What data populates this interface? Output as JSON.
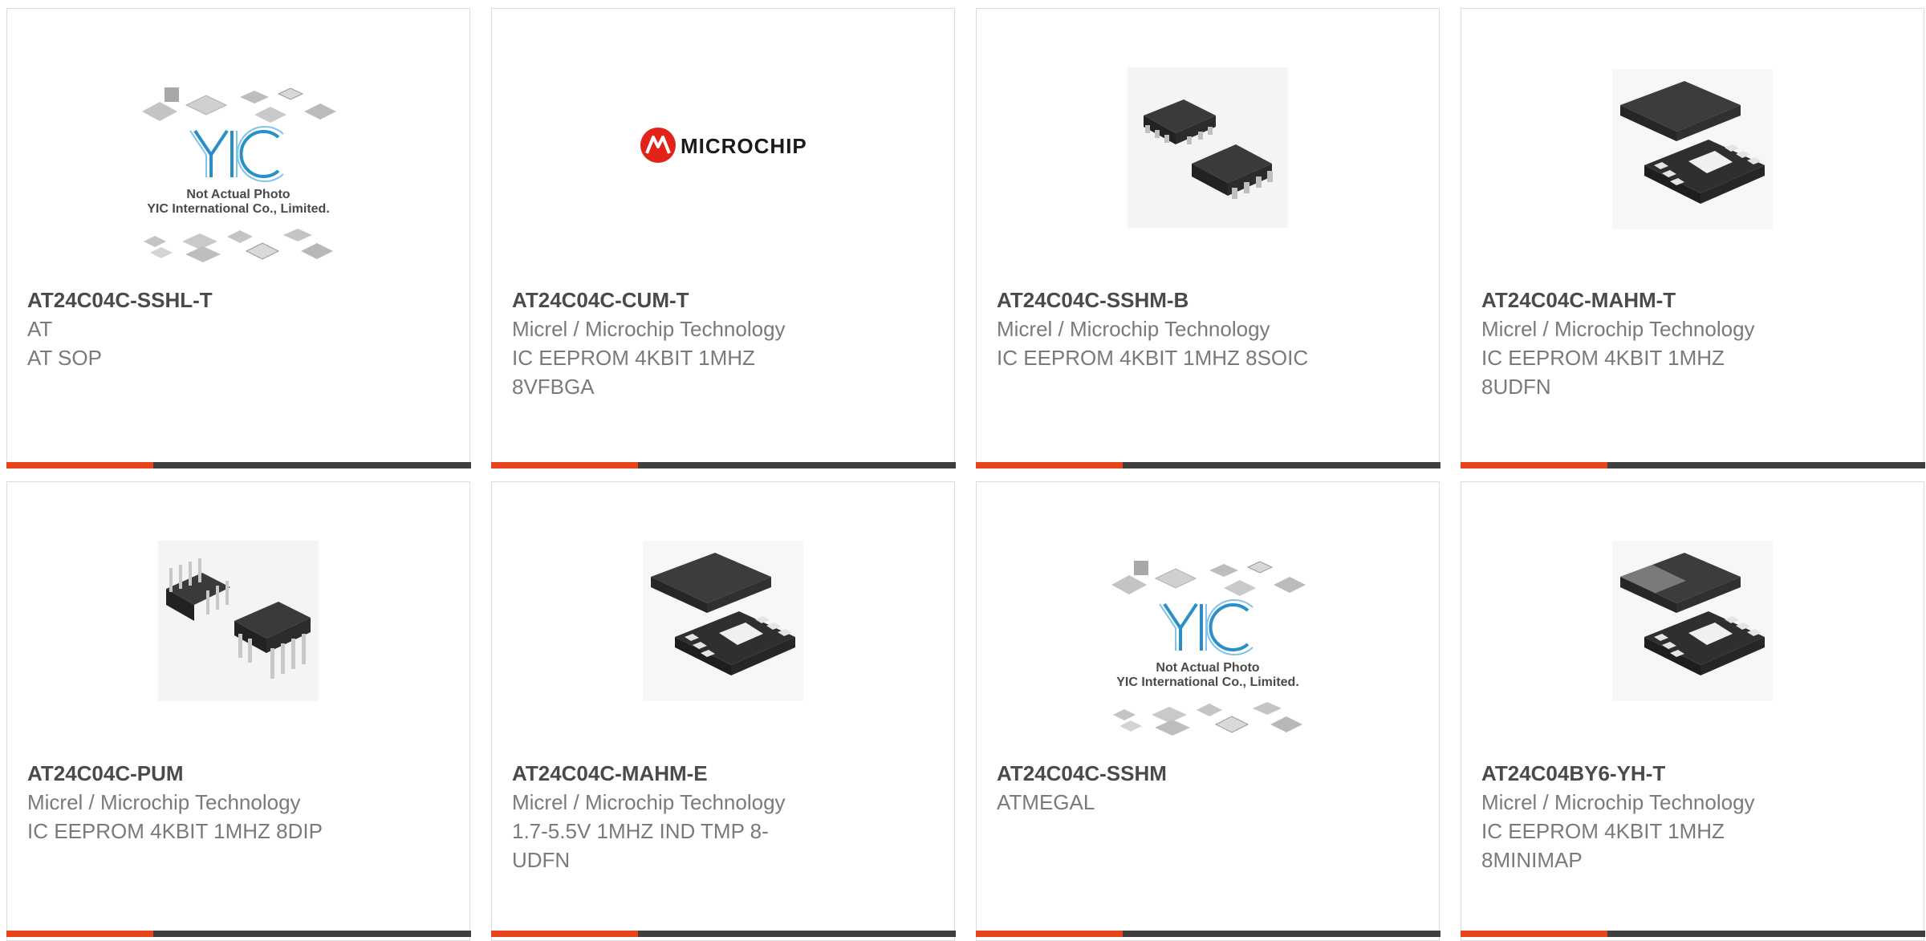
{
  "colors": {
    "accent": "#e8431a",
    "bar_dark": "#3f3f3f",
    "part_number": "#4a4a4a",
    "secondary_text": "#7a7a7a",
    "card_border": "#dcdcdc"
  },
  "products": [
    {
      "part_number": "AT24C04C-SSHL-T",
      "manufacturer": "AT",
      "description": "AT SOP",
      "image": "yic-placeholder",
      "placeholder_caption_1": "Not Actual Photo",
      "placeholder_caption_2": "YIC International Co., Limited."
    },
    {
      "part_number": "AT24C04C-CUM-T",
      "manufacturer": "Micrel / Microchip Technology",
      "description": "IC EEPROM 4KBIT 1MHZ 8VFBGA",
      "image": "microchip-logo",
      "logo_text": "MICROCHIP"
    },
    {
      "part_number": "AT24C04C-SSHM-B",
      "manufacturer": "Micrel / Microchip Technology",
      "description": "IC EEPROM 4KBIT 1MHZ 8SOIC",
      "image": "soic-chip"
    },
    {
      "part_number": "AT24C04C-MAHM-T",
      "manufacturer": "Micrel / Microchip Technology",
      "description": "IC EEPROM 4KBIT 1MHZ 8UDFN",
      "image": "udfn-chip"
    },
    {
      "part_number": "AT24C04C-PUM",
      "manufacturer": "Micrel / Microchip Technology",
      "description": "IC EEPROM 4KBIT 1MHZ 8DIP",
      "image": "dip-chip"
    },
    {
      "part_number": "AT24C04C-MAHM-E",
      "manufacturer": "Micrel / Microchip Technology",
      "description": "1.7-5.5V 1MHZ IND TMP 8-UDFN",
      "image": "udfn-chip"
    },
    {
      "part_number": "AT24C04C-SSHM",
      "manufacturer": "ATMEGAL",
      "description": "",
      "image": "yic-placeholder",
      "placeholder_caption_1": "Not Actual Photo",
      "placeholder_caption_2": "YIC International Co., Limited."
    },
    {
      "part_number": "AT24C04BY6-YH-T",
      "manufacturer": "Micrel / Microchip Technology",
      "description": "IC EEPROM 4KBIT 1MHZ 8MINIMAP",
      "image": "minimap-chip"
    }
  ]
}
